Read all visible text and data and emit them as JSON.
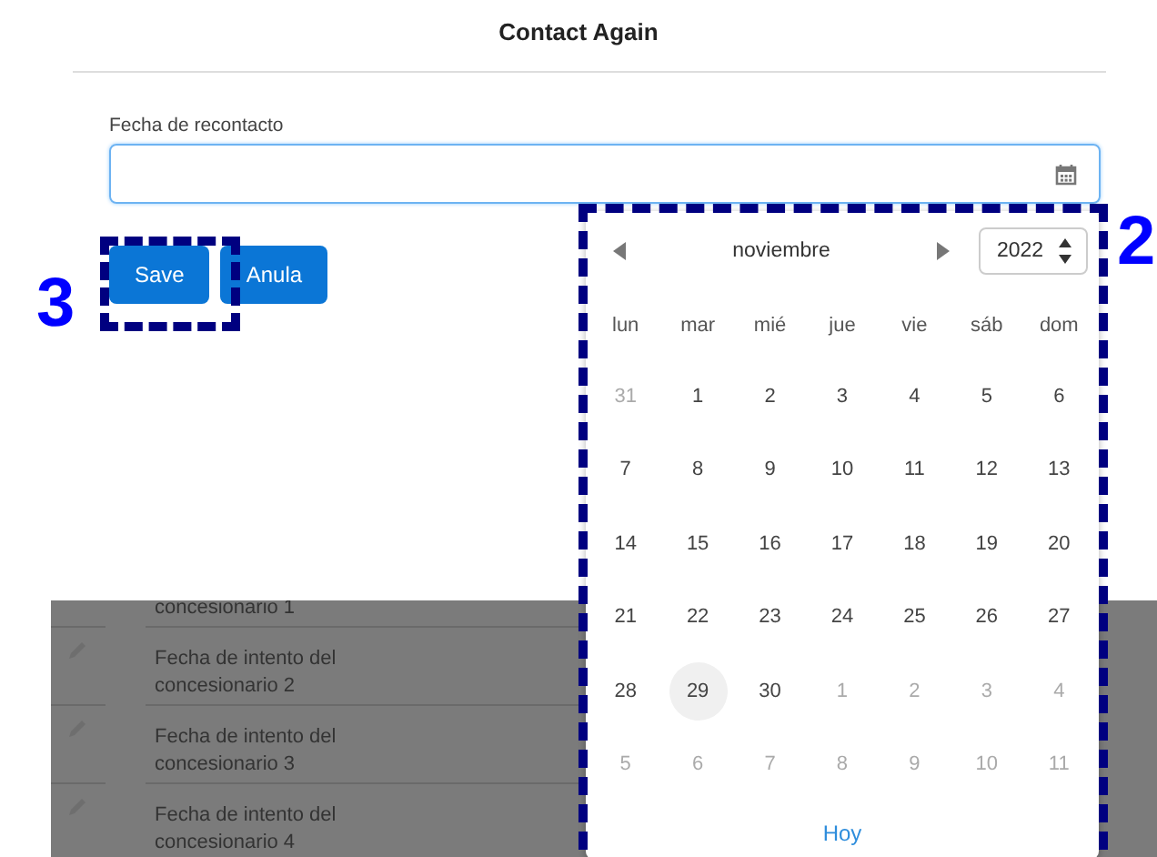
{
  "modal": {
    "title": "Contact Again",
    "field": {
      "label": "Fecha de recontacto"
    },
    "buttons": [
      {
        "label": "Save",
        "kind": "primary"
      },
      {
        "label": "Anula",
        "kind": "primary"
      }
    ]
  },
  "background_list": {
    "rows": [
      {
        "text": "concesionario 1",
        "icon": false
      },
      {
        "text": "Fecha de intento del concesionario 2",
        "icon": true
      },
      {
        "text": "Fecha de intento del concesionario 3",
        "icon": true
      },
      {
        "text": "Fecha de intento del concesionario 4",
        "icon": true
      }
    ]
  },
  "date_picker": {
    "month": "noviembre",
    "year": "2022",
    "weekdays": [
      "lun",
      "mar",
      "mié",
      "jue",
      "vie",
      "sáb",
      "dom"
    ],
    "weeks": [
      [
        {
          "day": "31",
          "muted": true,
          "selected": false
        },
        {
          "day": "1",
          "muted": false,
          "selected": false
        },
        {
          "day": "2",
          "muted": false,
          "selected": false
        },
        {
          "day": "3",
          "muted": false,
          "selected": false
        },
        {
          "day": "4",
          "muted": false,
          "selected": false
        },
        {
          "day": "5",
          "muted": false,
          "selected": false
        },
        {
          "day": "6",
          "muted": false,
          "selected": false
        }
      ],
      [
        {
          "day": "7",
          "muted": false,
          "selected": false
        },
        {
          "day": "8",
          "muted": false,
          "selected": false
        },
        {
          "day": "9",
          "muted": false,
          "selected": false
        },
        {
          "day": "10",
          "muted": false,
          "selected": false
        },
        {
          "day": "11",
          "muted": false,
          "selected": false
        },
        {
          "day": "12",
          "muted": false,
          "selected": false
        },
        {
          "day": "13",
          "muted": false,
          "selected": false
        }
      ],
      [
        {
          "day": "14",
          "muted": false,
          "selected": false
        },
        {
          "day": "15",
          "muted": false,
          "selected": false
        },
        {
          "day": "16",
          "muted": false,
          "selected": false
        },
        {
          "day": "17",
          "muted": false,
          "selected": false
        },
        {
          "day": "18",
          "muted": false,
          "selected": false
        },
        {
          "day": "19",
          "muted": false,
          "selected": false
        },
        {
          "day": "20",
          "muted": false,
          "selected": false
        }
      ],
      [
        {
          "day": "21",
          "muted": false,
          "selected": false
        },
        {
          "day": "22",
          "muted": false,
          "selected": false
        },
        {
          "day": "23",
          "muted": false,
          "selected": false
        },
        {
          "day": "24",
          "muted": false,
          "selected": false
        },
        {
          "day": "25",
          "muted": false,
          "selected": false
        },
        {
          "day": "26",
          "muted": false,
          "selected": false
        },
        {
          "day": "27",
          "muted": false,
          "selected": false
        }
      ],
      [
        {
          "day": "28",
          "muted": false,
          "selected": false
        },
        {
          "day": "29",
          "muted": false,
          "selected": true
        },
        {
          "day": "30",
          "muted": false,
          "selected": false
        },
        {
          "day": "1",
          "muted": true,
          "selected": false
        },
        {
          "day": "2",
          "muted": true,
          "selected": false
        },
        {
          "day": "3",
          "muted": true,
          "selected": false
        },
        {
          "day": "4",
          "muted": true,
          "selected": false
        }
      ],
      [
        {
          "day": "5",
          "muted": true,
          "selected": false
        },
        {
          "day": "6",
          "muted": true,
          "selected": false
        },
        {
          "day": "7",
          "muted": true,
          "selected": false
        },
        {
          "day": "8",
          "muted": true,
          "selected": false
        },
        {
          "day": "9",
          "muted": true,
          "selected": false
        },
        {
          "day": "10",
          "muted": true,
          "selected": false
        },
        {
          "day": "11",
          "muted": true,
          "selected": false
        }
      ]
    ],
    "today_link": "Hoy"
  },
  "annotations": [
    {
      "label": "3"
    },
    {
      "label": "2"
    }
  ]
}
